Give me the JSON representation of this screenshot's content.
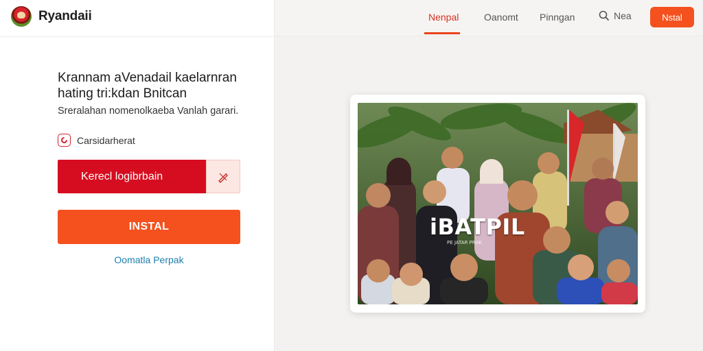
{
  "brand": {
    "name": "Ryandaii",
    "logo_icon": "garuda-logo-icon"
  },
  "hero": {
    "heading_line1": "Krannam aVenadail kaelarnran",
    "heading_line2": "hating tri:kdan Bnitcan",
    "subtext": "Sreralahan nomenolkaeba Vanlah garari.",
    "checkbox_label": "Carsidarherat",
    "red_button_label": "Kerecl  logibrbain",
    "side_icon": "pencil-cross-icon",
    "install_label": "INSTAL",
    "link_text": "Oomatla Perpak"
  },
  "nav": {
    "items": [
      "Nenpal",
      "Oanomt",
      "Pinngan"
    ],
    "active": "Nenpal",
    "search_label": "Nea",
    "install_label": "Nstal"
  },
  "photo": {
    "overlay_title": "iBATPIL",
    "overlay_subtitle": "PE JATAR PRAK"
  },
  "colors": {
    "accent": "#f4511e",
    "red": "#d60d20",
    "link": "#1b7fae"
  }
}
